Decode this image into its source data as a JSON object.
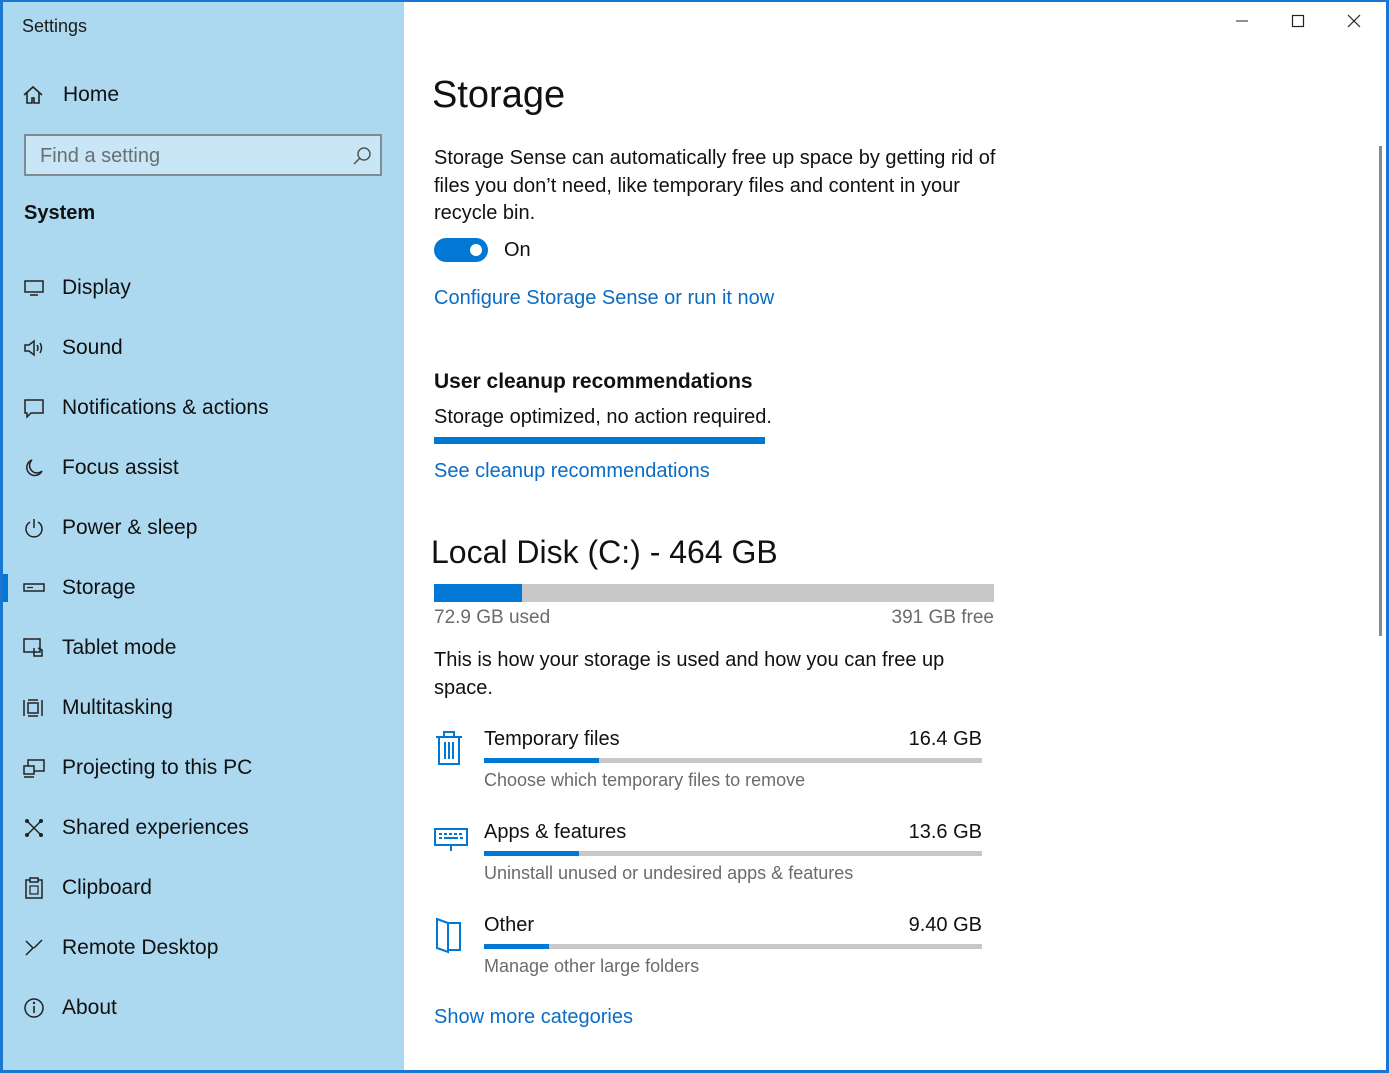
{
  "window": {
    "title": "Settings",
    "controls": {
      "minimize": "minimize-icon",
      "maximize": "maximize-icon",
      "close": "close-icon"
    }
  },
  "sidebar": {
    "home_label": "Home",
    "search_placeholder": "Find a setting",
    "section": "System",
    "items": [
      {
        "label": "Display",
        "icon": "monitor-icon"
      },
      {
        "label": "Sound",
        "icon": "speaker-icon"
      },
      {
        "label": "Notifications & actions",
        "icon": "message-icon"
      },
      {
        "label": "Focus assist",
        "icon": "moon-icon"
      },
      {
        "label": "Power & sleep",
        "icon": "power-icon"
      },
      {
        "label": "Storage",
        "icon": "drive-icon",
        "active": true
      },
      {
        "label": "Tablet mode",
        "icon": "tablet-icon"
      },
      {
        "label": "Multitasking",
        "icon": "multitask-icon"
      },
      {
        "label": "Projecting to this PC",
        "icon": "projector-icon"
      },
      {
        "label": "Shared experiences",
        "icon": "shared-icon"
      },
      {
        "label": "Clipboard",
        "icon": "clipboard-icon"
      },
      {
        "label": "Remote Desktop",
        "icon": "remote-icon"
      },
      {
        "label": "About",
        "icon": "info-icon"
      }
    ]
  },
  "main": {
    "title": "Storage",
    "storage_sense_desc": "Storage Sense can automatically free up space by getting rid of files you don’t need, like temporary files and content in your recycle bin.",
    "toggle_state": "On",
    "configure_link": "Configure Storage Sense or run it now",
    "cleanup": {
      "heading": "User cleanup recommendations",
      "status": "Storage optimized, no action required.",
      "link": "See cleanup recommendations"
    },
    "disk": {
      "title": "Local Disk (C:) - 464 GB",
      "used": "72.9 GB used",
      "free": "391 GB free",
      "used_fraction": 0.157,
      "usage_desc": "This is how your storage is used and how you can free up space."
    },
    "categories": [
      {
        "name": "Temporary files",
        "size": "16.4 GB",
        "hint": "Choose which temporary files to remove",
        "fraction": 0.23,
        "icon": "trash-icon"
      },
      {
        "name": "Apps & features",
        "size": "13.6 GB",
        "hint": "Uninstall unused or undesired apps & features",
        "fraction": 0.19,
        "icon": "keyboard-monitor-icon"
      },
      {
        "name": "Other",
        "size": "9.40 GB",
        "hint": "Manage other large folders",
        "fraction": 0.13,
        "icon": "folder-icon"
      }
    ],
    "show_more_link": "Show more categories"
  },
  "colors": {
    "accent": "#0078d4",
    "sidebar_bg": "#acd9f0",
    "link": "#0a6cc4"
  }
}
